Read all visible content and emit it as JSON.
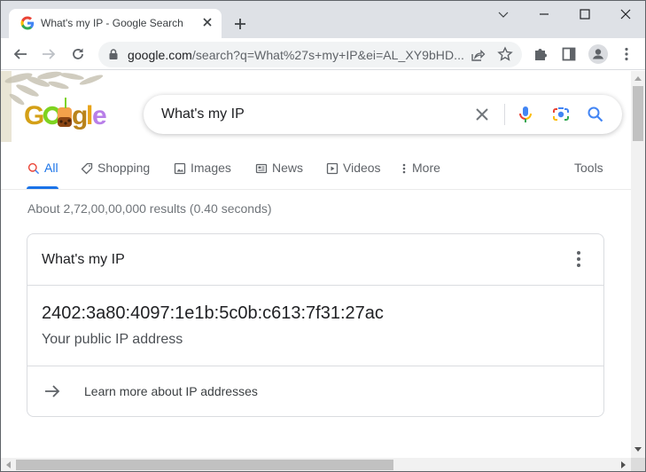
{
  "browser": {
    "tab": {
      "title": "What's my IP - Google Search",
      "favicon": "google-g-icon",
      "close_icon": "close-icon"
    },
    "new_tab_icon": "plus-icon",
    "window_controls": [
      "tab-search-chevron-icon",
      "minimize-icon",
      "maximize-icon",
      "close-icon"
    ],
    "toolbar": {
      "back_icon": "arrow-left-icon",
      "forward_icon": "arrow-right-icon",
      "reload_icon": "reload-icon",
      "url_domain": "google.com",
      "url_rest": "/search?q=What%27s+my+IP&ei=AL_XY9bHD...",
      "share_icon": "share-icon",
      "bookmark_icon": "star-icon",
      "extensions_icon": "puzzle-icon",
      "side_panel_icon": "side-panel-icon",
      "profile_icon": "avatar-icon",
      "menu_icon": "kebab-menu-icon"
    }
  },
  "search": {
    "logo_text": "Google",
    "query": "What's my IP",
    "icons": [
      "clear-icon",
      "microphone-icon",
      "camera-lens-icon",
      "search-icon"
    ],
    "tabs": [
      {
        "label": "All",
        "icon": "search-icon",
        "active": true
      },
      {
        "label": "Shopping",
        "icon": "tag-icon",
        "active": false
      },
      {
        "label": "Images",
        "icon": "image-icon",
        "active": false
      },
      {
        "label": "News",
        "icon": "newspaper-icon",
        "active": false
      },
      {
        "label": "Videos",
        "icon": "play-icon",
        "active": false
      },
      {
        "label": "More",
        "icon": "more-vert-icon",
        "active": false
      }
    ],
    "tools_label": "Tools",
    "result_stats": "About 2,72,00,00,000 results (0.40 seconds)"
  },
  "ip_card": {
    "title": "What's my IP",
    "ip_address": "2402:3a80:4097:1e1b:5c0b:c613:7f31:27ac",
    "ip_label": "Your public IP address",
    "learn_more": "Learn more about IP addresses"
  },
  "colors": {
    "accent_blue": "#1a73e8",
    "tab_strip": "#dee1e6",
    "omnibox_bg": "#f1f3f4"
  }
}
